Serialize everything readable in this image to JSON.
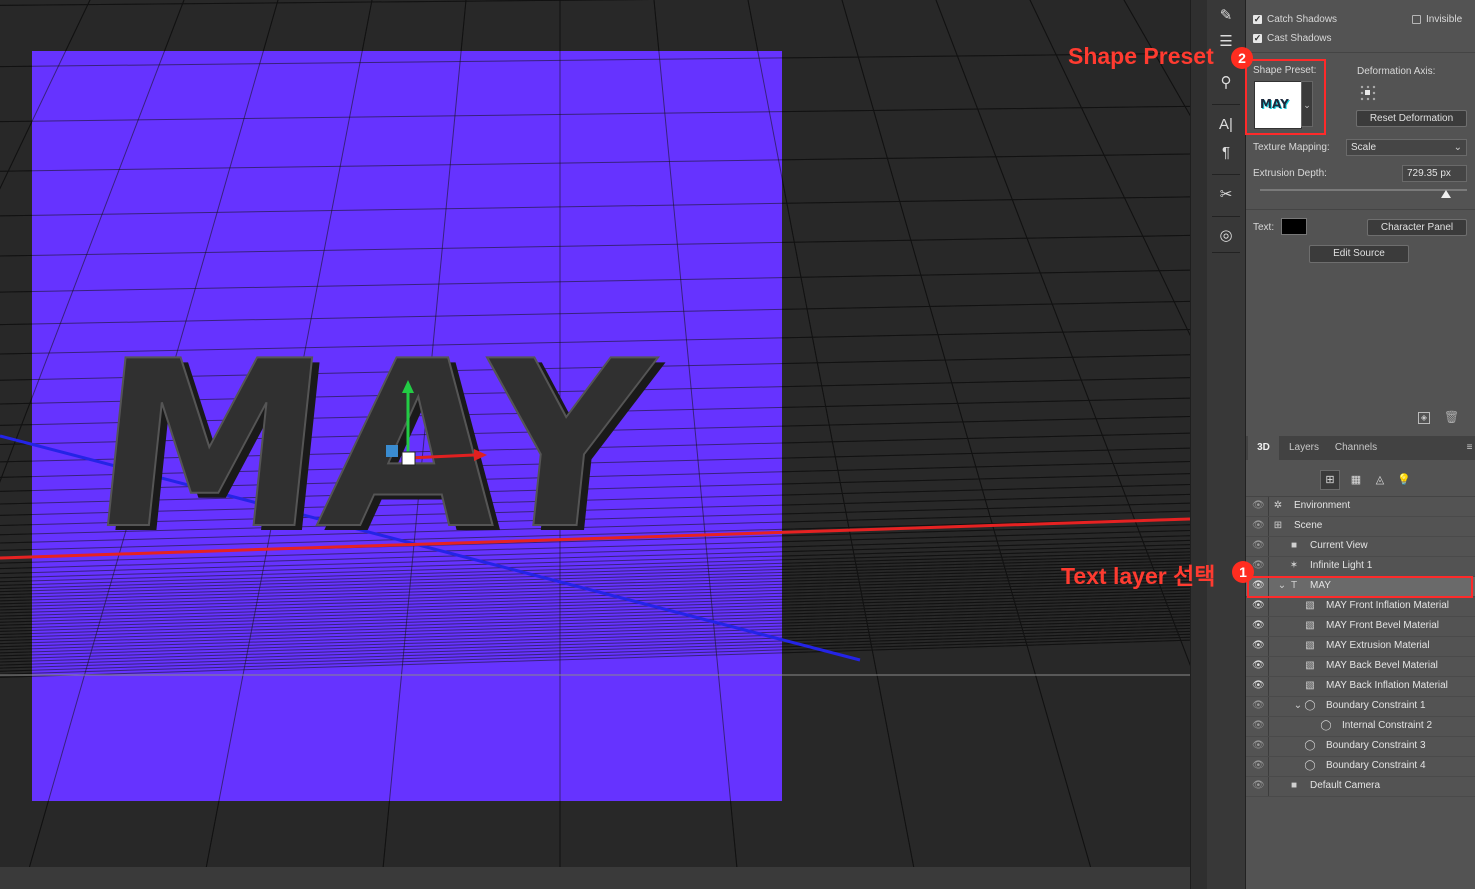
{
  "properties": {
    "catch_shadows": "Catch Shadows",
    "invisible": "Invisible",
    "cast_shadows": "Cast Shadows",
    "shape_preset_label": "Shape Preset:",
    "shape_preset_thumb_text": "MAY",
    "deformation_axis_label": "Deformation Axis:",
    "reset_deformation": "Reset Deformation",
    "texture_mapping_label": "Texture Mapping:",
    "texture_mapping_value": "Scale",
    "extrusion_depth_label": "Extrusion Depth:",
    "extrusion_depth_value": "729.35 px",
    "extrusion_slider_fraction": 0.9,
    "text_label": "Text:",
    "character_panel": "Character Panel",
    "edit_source": "Edit Source"
  },
  "panel": {
    "tabs": [
      "3D",
      "Layers",
      "Channels"
    ],
    "menu_icon": "≡",
    "filter_icons": [
      "scene-icon",
      "mesh-icon",
      "material-icon",
      "light-icon"
    ],
    "layers": [
      {
        "label": "Environment",
        "icon": "environment-icon"
      },
      {
        "label": "Scene",
        "icon": "scene-icon"
      },
      {
        "label": "Current View",
        "icon": "camera-icon"
      },
      {
        "label": "Infinite Light 1",
        "icon": "light-icon"
      },
      {
        "label": "MAY",
        "icon": "mesh-icon"
      },
      {
        "label": "MAY Front Inflation Material",
        "icon": "material-icon"
      },
      {
        "label": "MAY Front Bevel Material",
        "icon": "material-icon"
      },
      {
        "label": "MAY Extrusion Material",
        "icon": "material-icon"
      },
      {
        "label": "MAY Back Bevel Material",
        "icon": "material-icon"
      },
      {
        "label": "MAY Back Inflation Material",
        "icon": "material-icon"
      },
      {
        "label": "Boundary Constraint 1",
        "icon": "constraint-icon"
      },
      {
        "label": "Internal Constraint 2",
        "icon": "constraint-icon"
      },
      {
        "label": "Boundary Constraint 3",
        "icon": "constraint-icon"
      },
      {
        "label": "Boundary Constraint 4",
        "icon": "constraint-icon"
      },
      {
        "label": "Default Camera",
        "icon": "camera-icon"
      }
    ]
  },
  "canvas": {
    "text_3d": "MAY",
    "colors": {
      "background": "#6633ff",
      "text": "#2e2e2e",
      "grid": "#111111",
      "x_axis": "#e02020",
      "z_axis": "#2020e0",
      "y_axis": "#22cc44"
    }
  },
  "annotations": {
    "shape_preset": "Shape Preset",
    "badge_2": "2",
    "text_layer": "Text layer 선택",
    "badge_1": "1",
    "color": "#ff3b30"
  }
}
